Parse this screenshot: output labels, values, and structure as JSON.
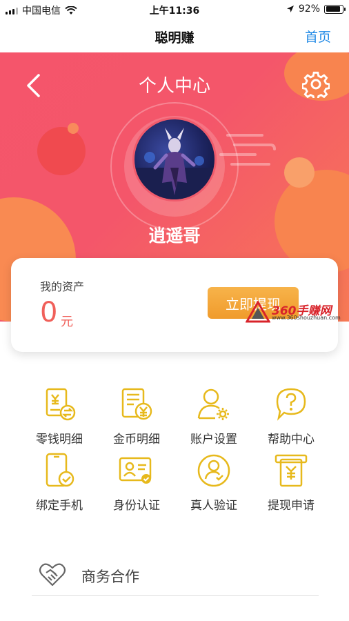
{
  "status_bar": {
    "carrier": "中国电信",
    "time": "上午11:36",
    "battery": "92%",
    "battery_level": 0.92
  },
  "nav_bar": {
    "title": "聪明赚",
    "home_link": "首页",
    "link_color": "#1e88e5"
  },
  "profile": {
    "page_title": "个人中心",
    "username": "逍遥哥",
    "back_icon": "chevron-left-icon",
    "settings_icon": "gear-icon"
  },
  "assets": {
    "label": "我的资产",
    "amount": "0",
    "unit": "元",
    "withdraw_button": "立即提现",
    "amount_color": "#f0605a"
  },
  "watermark": {
    "brand": "360手赚网",
    "url": "www.360shouzhuan.com"
  },
  "menu": {
    "items": [
      {
        "label": "零钱明细",
        "icon": "change-detail-icon"
      },
      {
        "label": "金币明细",
        "icon": "coin-detail-icon"
      },
      {
        "label": "账户设置",
        "icon": "account-settings-icon"
      },
      {
        "label": "帮助中心",
        "icon": "help-icon"
      },
      {
        "label": "绑定手机",
        "icon": "bind-phone-icon"
      },
      {
        "label": "身份认证",
        "icon": "id-card-icon"
      },
      {
        "label": "真人验证",
        "icon": "face-verify-icon"
      },
      {
        "label": "提现申请",
        "icon": "withdraw-apply-icon"
      }
    ],
    "icon_color": "#e7b91c"
  },
  "business": {
    "label": "商务合作",
    "icon": "handshake-heart-icon"
  },
  "colors": {
    "hero_start": "#f5556b",
    "hero_end": "#f77a55",
    "button_orange": "#f09b2c"
  }
}
